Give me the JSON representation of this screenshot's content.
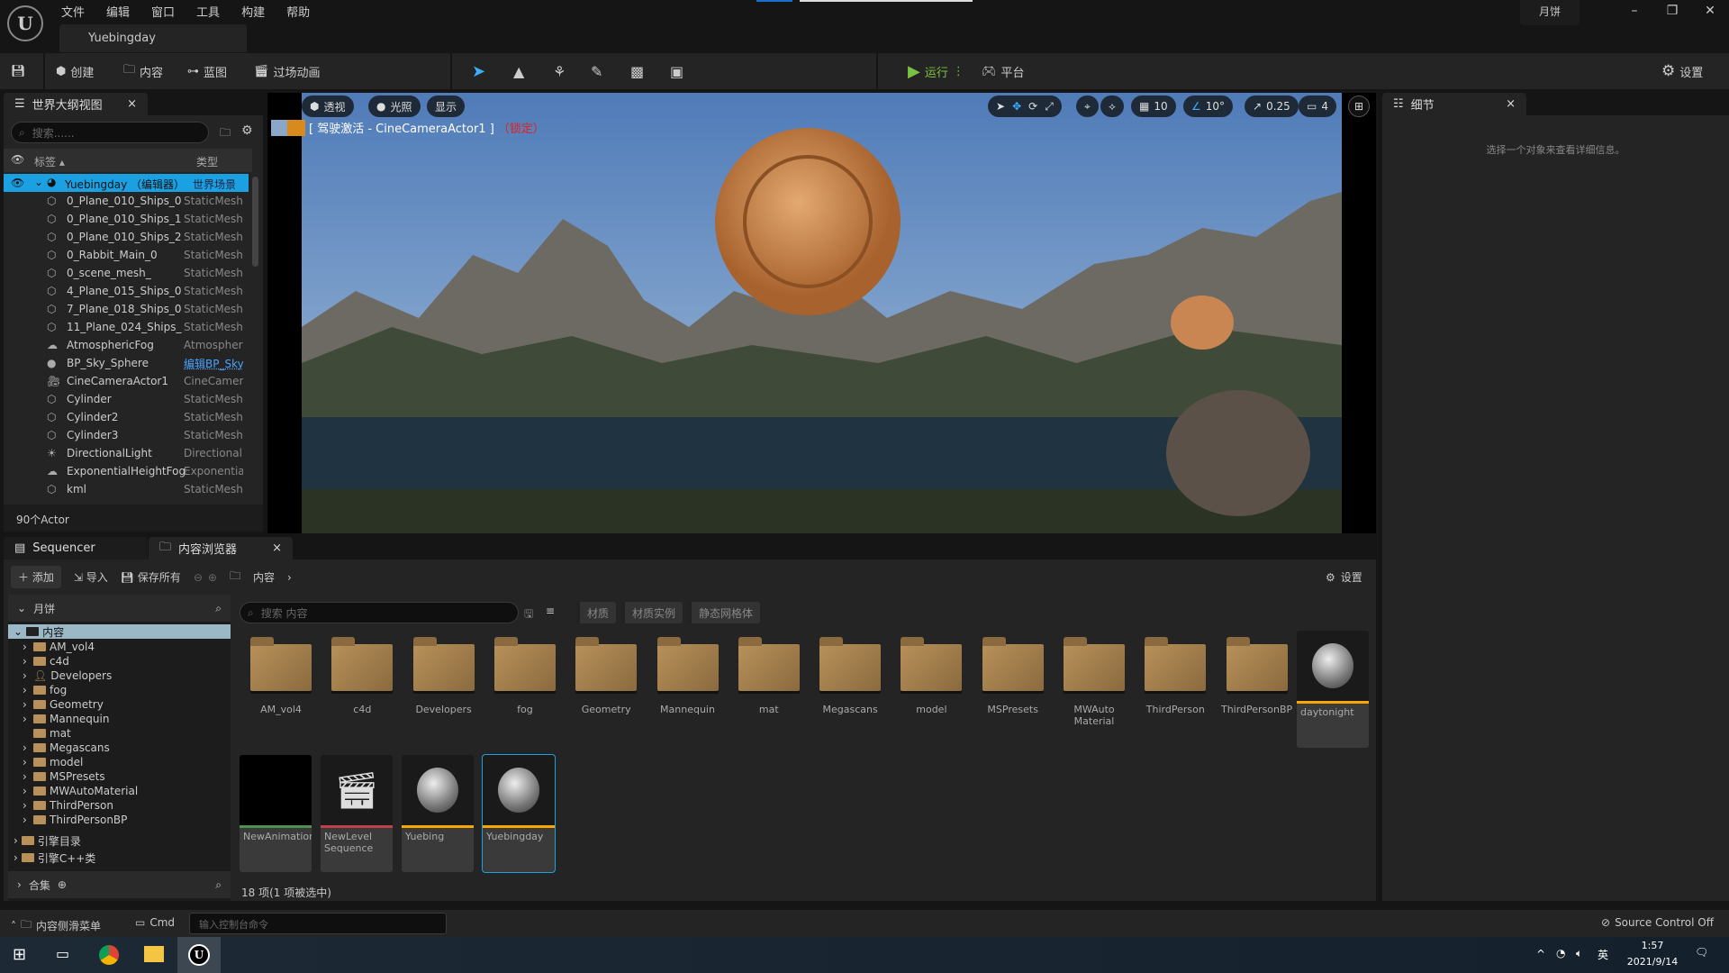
{
  "menubar": {
    "items": [
      "文件",
      "编辑",
      "窗口",
      "工具",
      "构建",
      "帮助"
    ],
    "doc_tab": "Yuebingday",
    "project": "月饼"
  },
  "toolbar": {
    "save_icon": "save-icon",
    "create": "创建",
    "content": "内容",
    "blueprint": "蓝图",
    "cinematics": "过场动画",
    "play": "运行",
    "platform": "平台",
    "settings": "设置"
  },
  "outliner": {
    "title": "世界大纲视图",
    "search_placeholder": "搜索......",
    "col_label": "标签",
    "col_type": "类型",
    "root": {
      "name": "Yuebingday （编辑器）",
      "type": "世界场景"
    },
    "items": [
      {
        "name": "0_Plane_010_Ships_0",
        "type": "StaticMesh",
        "icon": "mesh-icon"
      },
      {
        "name": "0_Plane_010_Ships_1",
        "type": "StaticMesh",
        "icon": "mesh-icon"
      },
      {
        "name": "0_Plane_010_Ships_2",
        "type": "StaticMesh",
        "icon": "mesh-icon"
      },
      {
        "name": "0_Rabbit_Main_0",
        "type": "StaticMesh",
        "icon": "mesh-icon"
      },
      {
        "name": "0_scene_mesh_",
        "type": "StaticMesh",
        "icon": "mesh-icon"
      },
      {
        "name": "4_Plane_015_Ships_0",
        "type": "StaticMesh",
        "icon": "mesh-icon"
      },
      {
        "name": "7_Plane_018_Ships_0",
        "type": "StaticMesh",
        "icon": "mesh-icon"
      },
      {
        "name": "11_Plane_024_Ships_",
        "type": "StaticMesh",
        "icon": "mesh-icon"
      },
      {
        "name": "AtmosphericFog",
        "type": "Atmospheric",
        "icon": "fog-icon"
      },
      {
        "name": "BP_Sky_Sphere",
        "type": "编辑BP_Sky",
        "icon": "sphere-icon"
      },
      {
        "name": "CineCameraActor1",
        "type": "CineCamera",
        "icon": "camera-icon"
      },
      {
        "name": "Cylinder",
        "type": "StaticMesh",
        "icon": "mesh-icon"
      },
      {
        "name": "Cylinder2",
        "type": "StaticMesh",
        "icon": "mesh-icon"
      },
      {
        "name": "Cylinder3",
        "type": "StaticMesh",
        "icon": "mesh-icon"
      },
      {
        "name": "DirectionalLight",
        "type": "Directional",
        "icon": "light-icon"
      },
      {
        "name": "ExponentialHeightFog",
        "type": "Exponential",
        "icon": "fog-icon"
      },
      {
        "name": "kml",
        "type": "StaticMesh",
        "icon": "mesh-icon"
      }
    ],
    "count": "90个Actor"
  },
  "viewport": {
    "perspective": "透视",
    "lighting": "光照",
    "show": "显示",
    "pilot_label": "[ 驾驶激活 - CineCameraActor1 ]",
    "locked": "（锁定）",
    "grid": "10",
    "angle": "10°",
    "scale": "0.25",
    "cam_speed": "4",
    "link_color": "#4aa3ff",
    "accent": "#1ba1e2"
  },
  "details": {
    "title": "细节",
    "empty": "选择一个对象来查看详细信息。"
  },
  "bottom_tabs": {
    "sequencer": "Sequencer",
    "content_browser": "内容浏览器"
  },
  "content": {
    "add": "添加",
    "import": "导入",
    "save_all": "保存所有",
    "path": "内容",
    "settings": "设置",
    "tree_root": "月饼",
    "tree_content": "内容",
    "tree": [
      "AM_vol4",
      "c4d",
      "Developers",
      "fog",
      "Geometry",
      "Mannequin",
      "mat",
      "Megascans",
      "model",
      "MSPresets",
      "MWAutoMaterial",
      "ThirdPerson",
      "ThirdPersonBP"
    ],
    "engine_content": "引擎目录",
    "engine_cpp": "引擎C++类",
    "collections": "合集",
    "search_placeholder": "搜索 内容",
    "filters": [
      "材质",
      "材质实例",
      "静态网格体"
    ],
    "folders": [
      "AM_vol4",
      "c4d",
      "Developers",
      "fog",
      "Geometry",
      "Mannequin",
      "mat",
      "Megascans",
      "model",
      "MSPresets",
      "MWAuto Material",
      "ThirdPerson",
      "ThirdPersonBP"
    ],
    "assets": [
      {
        "name": "daytonight",
        "color": "#f7a600"
      },
      {
        "name": "NewAnimation",
        "color": "#4f8f4f"
      },
      {
        "name": "NewLevel Sequence",
        "color": "#c0404a"
      },
      {
        "name": "Yuebing",
        "color": "#f7a600"
      },
      {
        "name": "Yuebingday",
        "color": "#f7a600",
        "selected": true
      }
    ],
    "status": "18 项(1 项被选中)"
  },
  "statusbar": {
    "drawer": "内容侧滑菜单",
    "cmd": "Cmd",
    "console_placeholder": "输入控制台命令",
    "source_control": "Source Control Off"
  },
  "taskbar": {
    "time": "1:57",
    "date": "2021/9/14",
    "ime": "英"
  }
}
